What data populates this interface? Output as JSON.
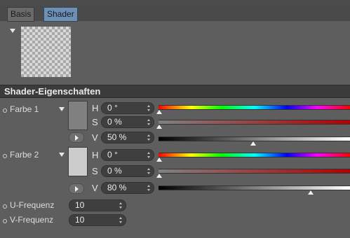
{
  "tabs": [
    {
      "label": "Basis",
      "active": false
    },
    {
      "label": "Shader",
      "active": true
    }
  ],
  "preview_icon": "checkerboard-preview",
  "section": {
    "title": "Shader-Eigenschaften"
  },
  "farbe1": {
    "label": "Farbe 1",
    "swatch_color": "#808080",
    "h": {
      "label": "H",
      "value": "0 °",
      "level": 0
    },
    "s": {
      "label": "S",
      "value": "0 %",
      "level": 0
    },
    "v": {
      "label": "V",
      "value": "50 %",
      "level": 0.5
    }
  },
  "farbe2": {
    "label": "Farbe 2",
    "swatch_color": "#cccccc",
    "h": {
      "label": "H",
      "value": "0 °",
      "level": 0
    },
    "s": {
      "label": "S",
      "value": "0 %",
      "level": 0
    },
    "v": {
      "label": "V",
      "value": "80 %",
      "level": 0.8
    }
  },
  "u_frequenz": {
    "label": "U-Frequenz",
    "value": "10"
  },
  "v_frequenz": {
    "label": "V-Frequenz",
    "value": "10"
  }
}
